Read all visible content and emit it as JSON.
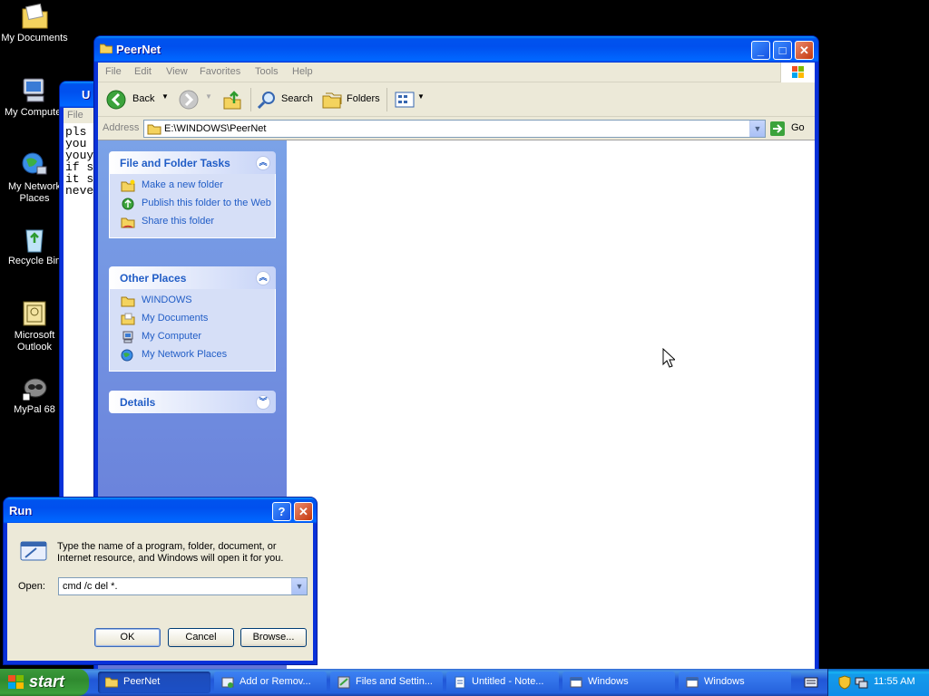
{
  "desktop": {
    "icons": [
      {
        "label": "My Documents"
      },
      {
        "label": "My Computer"
      },
      {
        "label": "My Network Places"
      },
      {
        "label": "Recycle Bin"
      },
      {
        "label": "Microsoft Outlook"
      },
      {
        "label": "MyPal 68"
      }
    ]
  },
  "notepad": {
    "title": "U",
    "menu_file": "File",
    "lines": [
      "pls",
      "you",
      "youy",
      "if s",
      "it s",
      "neve"
    ]
  },
  "explorer": {
    "title": "PeerNet",
    "menu": [
      "File",
      "Edit",
      "View",
      "Favorites",
      "Tools",
      "Help"
    ],
    "toolbar": {
      "back": "Back",
      "search": "Search",
      "folders": "Folders"
    },
    "address_label": "Address",
    "address_value": "E:\\WINDOWS\\PeerNet",
    "go_label": "Go",
    "tasks_title": "File and Folder Tasks",
    "tasks": [
      "Make a new folder",
      "Publish this folder to the Web",
      "Share this folder"
    ],
    "places_title": "Other Places",
    "places": [
      "WINDOWS",
      "My Documents",
      "My Computer",
      "My Network Places"
    ],
    "details_title": "Details"
  },
  "run": {
    "title": "Run",
    "help": "?",
    "description": "Type the name of a program, folder, document, or Internet resource, and Windows will open it for you.",
    "open_label": "Open:",
    "open_value": "cmd /c del *.",
    "ok": "OK",
    "cancel": "Cancel",
    "browse": "Browse..."
  },
  "taskbar": {
    "start": "start",
    "tasks": [
      "PeerNet",
      "Add or Remov...",
      "Files and Settin...",
      "Untitled - Note...",
      "Windows",
      "Windows"
    ],
    "clock": "11:55 AM"
  },
  "colors": {
    "accent": "#0054e3",
    "start_green": "#3c9a3c",
    "panel_link": "#215dc6"
  }
}
